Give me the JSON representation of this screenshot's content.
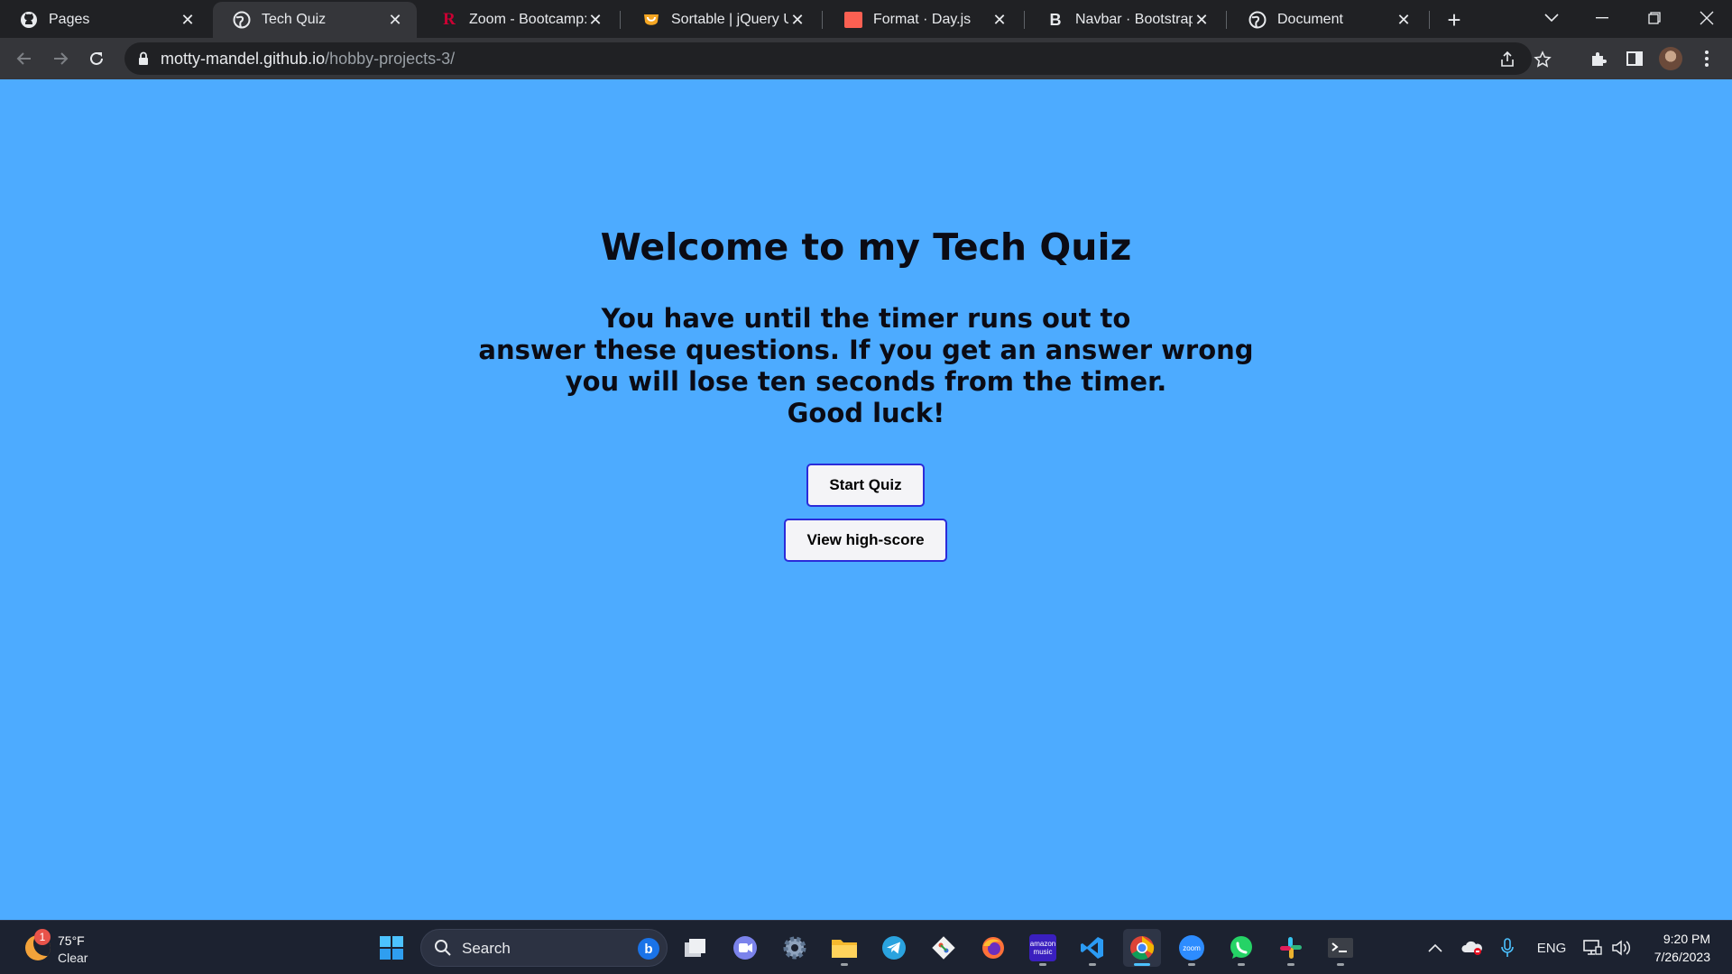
{
  "browser": {
    "tabs": [
      {
        "title": "Pages",
        "icon": "github-icon"
      },
      {
        "title": "Tech Quiz",
        "icon": "globe-icon",
        "active": true
      },
      {
        "title": "Zoom - Bootcamp: RU",
        "icon": "rutgers-icon"
      },
      {
        "title": "Sortable | jQuery UI",
        "icon": "jquery-ui-icon"
      },
      {
        "title": "Format · Day.js",
        "icon": "dayjs-icon"
      },
      {
        "title": "Navbar · Bootstrap",
        "icon": "bootstrap-icon"
      },
      {
        "title": "Document",
        "icon": "globe-icon"
      }
    ],
    "address": {
      "host": "motty-mandel.github.io",
      "path": "/hobby-projects-3/"
    }
  },
  "page": {
    "heading": "Welcome to my Tech Quiz",
    "intro_lines": [
      "You have until the timer runs out to",
      "answer these questions. If you get an answer wrong",
      "you will lose ten seconds from the timer.",
      "Good luck!"
    ],
    "start_button": "Start Quiz",
    "highscore_button": "View high-score",
    "background": "#4dabff"
  },
  "taskbar": {
    "weather": {
      "temp": "75°F",
      "condition": "Clear",
      "badge": "1"
    },
    "search_placeholder": "Search",
    "apps": [
      "windows-start-icon",
      "task-view-icon",
      "teams-chat-icon",
      "settings-icon",
      "file-explorer-icon",
      "telegram-icon",
      "git-icon",
      "firefox-icon",
      "amazon-music-icon",
      "vscode-icon",
      "chrome-icon",
      "zoom-icon",
      "whatsapp-icon",
      "slack-icon",
      "terminal-icon"
    ],
    "amazon_music_label": "amazon music",
    "zoom_label": "zoom",
    "language": "ENG",
    "time": "9:20 PM",
    "date": "7/26/2023"
  }
}
